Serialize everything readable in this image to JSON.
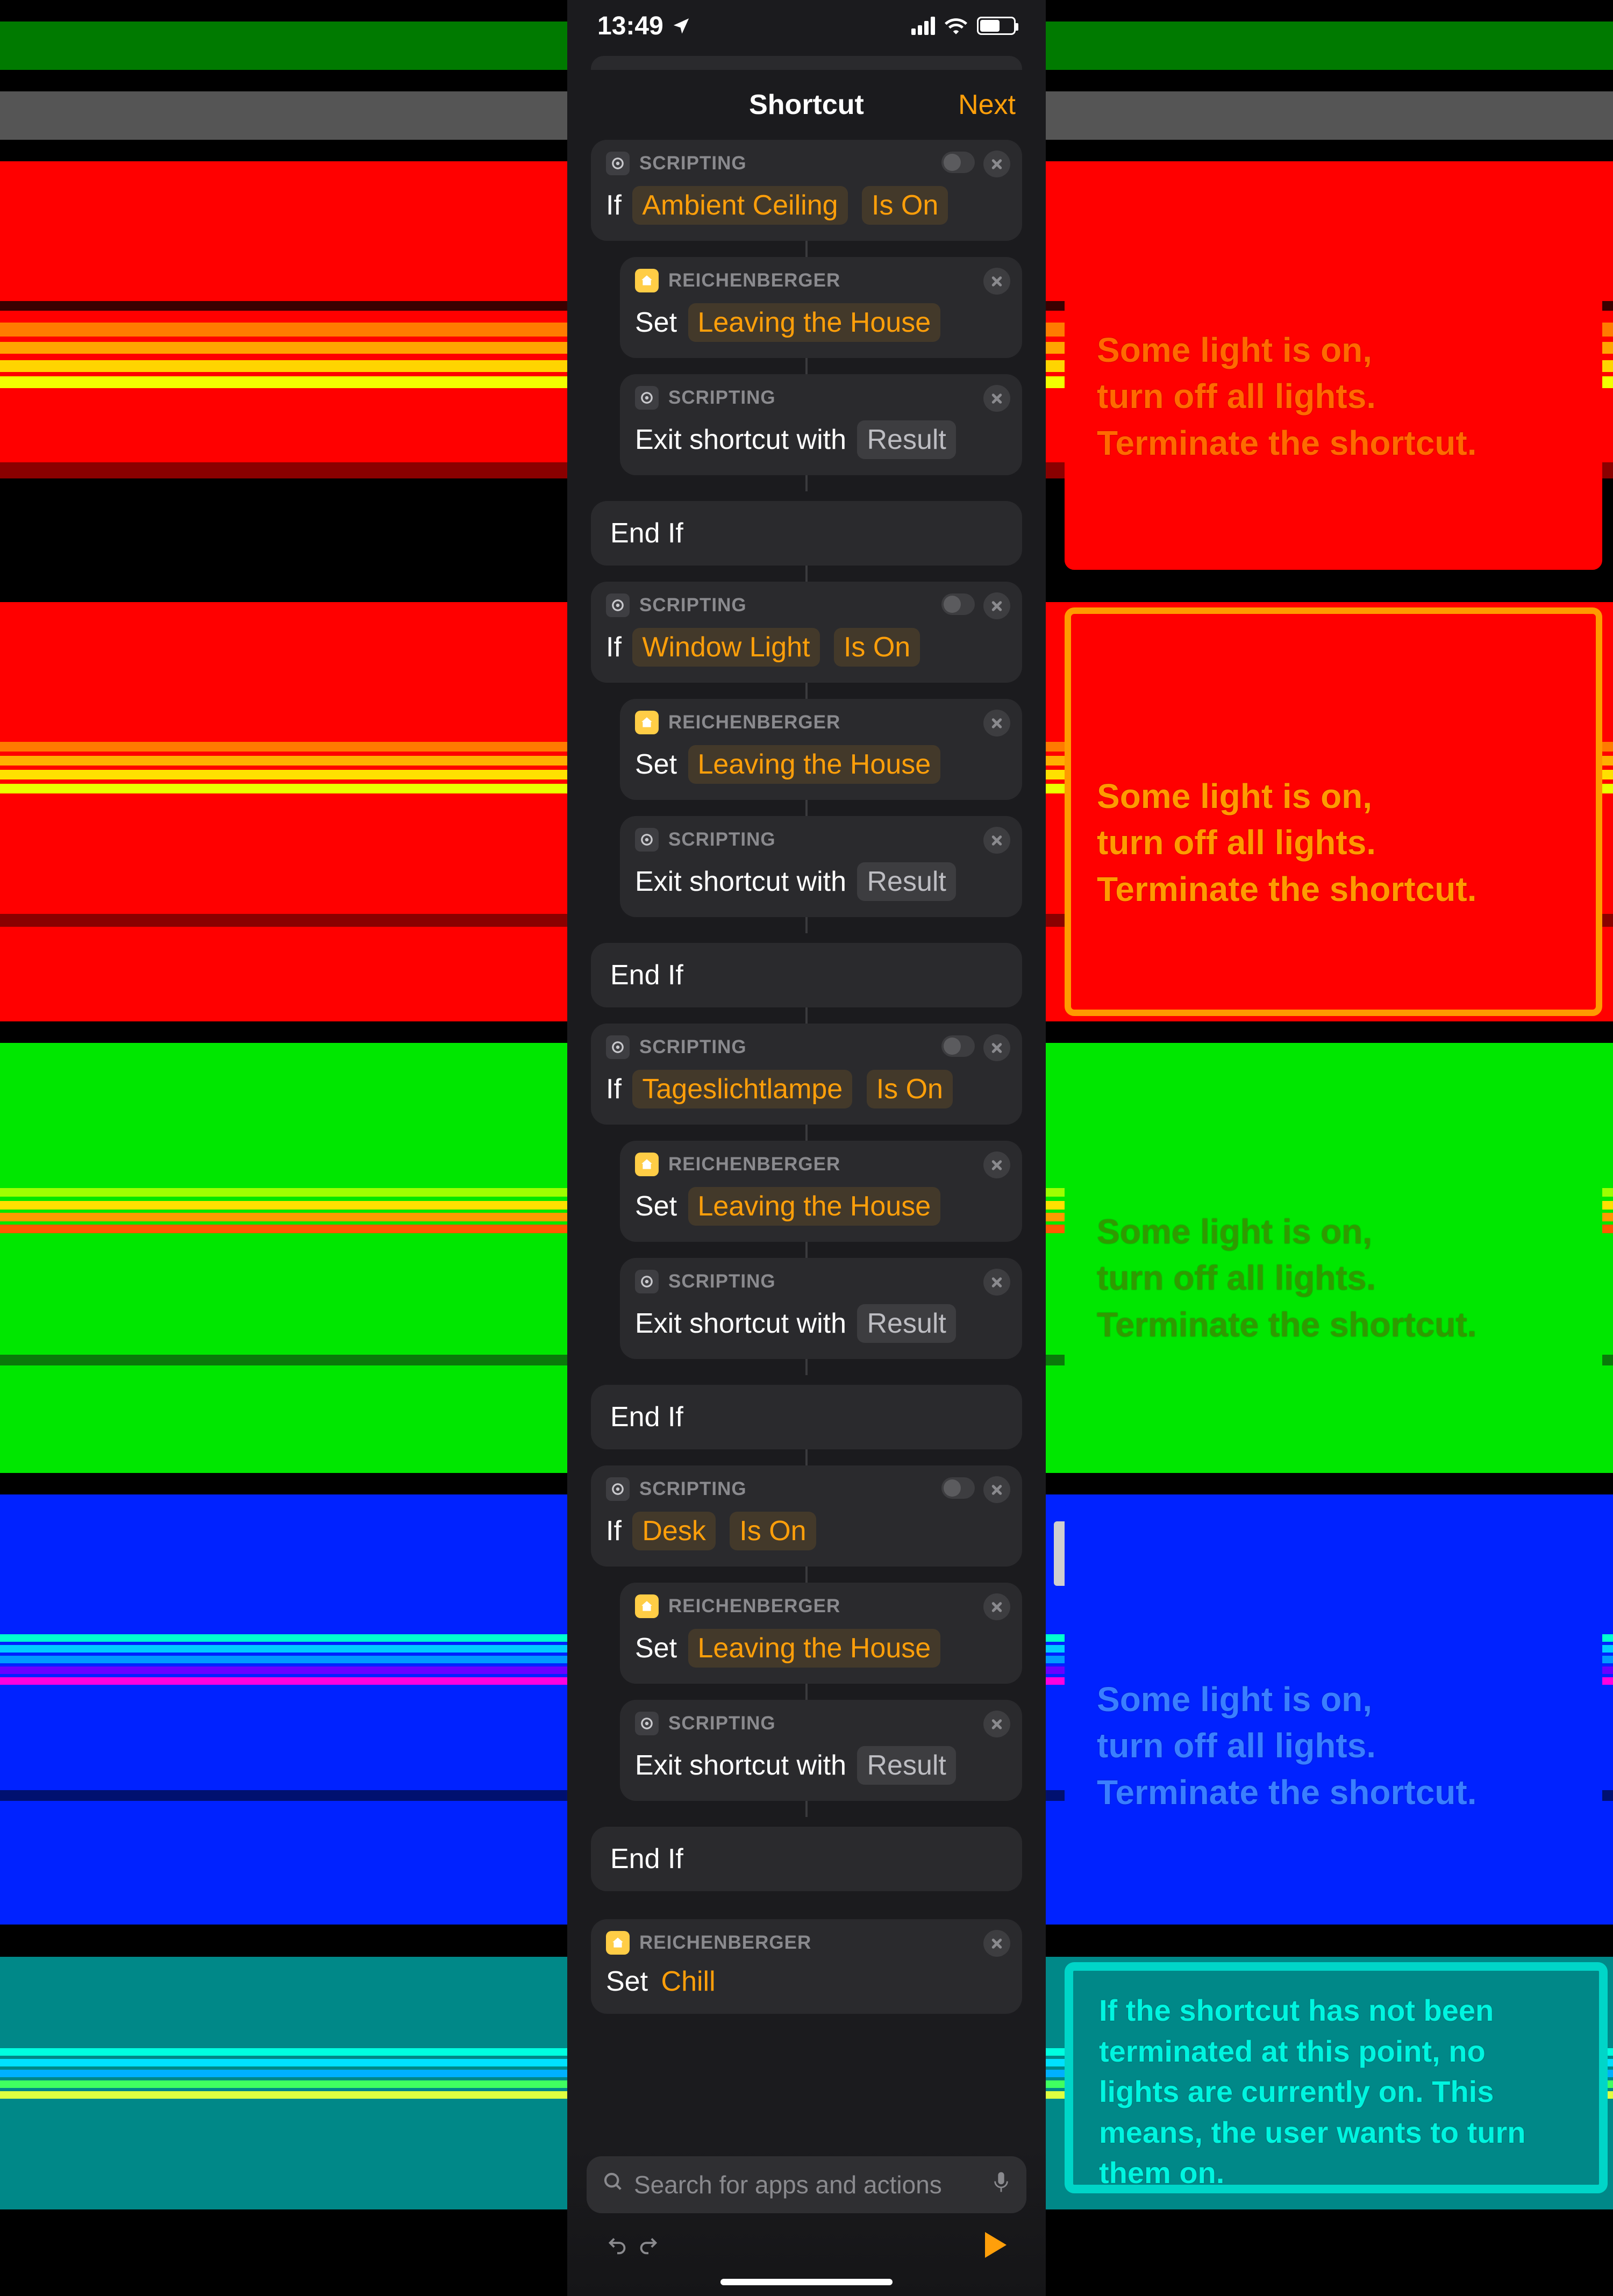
{
  "status": {
    "time": "13:49"
  },
  "header": {
    "title": "Shortcut",
    "next": "Next"
  },
  "labels": {
    "scripting": "SCRIPTING",
    "reichenberger": "REICHENBERGER",
    "if": "If",
    "set": "Set",
    "exit_prefix": "Exit shortcut with",
    "result": "Result",
    "endif": "End If",
    "is_on": "Is On"
  },
  "groups": [
    {
      "device": "Ambient Ceiling",
      "scene": "Leaving the House"
    },
    {
      "device": "Window Light",
      "scene": "Leaving the House"
    },
    {
      "device": "Tageslichtlampe",
      "scene": "Leaving the House"
    },
    {
      "device": "Desk",
      "scene": "Leaving the House"
    }
  ],
  "final_set": {
    "scene": "Chill"
  },
  "search": {
    "placeholder": "Search for apps and actions"
  },
  "annotations": {
    "a1": "Some light is on,\nturn off all lights.\nTerminate the shortcut.",
    "a2": "Some light is on,\nturn off all lights.\nTerminate the shortcut.",
    "a3": "Some light is on,\nturn off all lights.\nTerminate the shortcut.",
    "a4": "Some light is on,\nturn off all lights.\nTerminate the shortcut.",
    "a5": "If the shortcut has not been terminated at this point, no lights are currently on. This means, the user wants to turn them on."
  }
}
